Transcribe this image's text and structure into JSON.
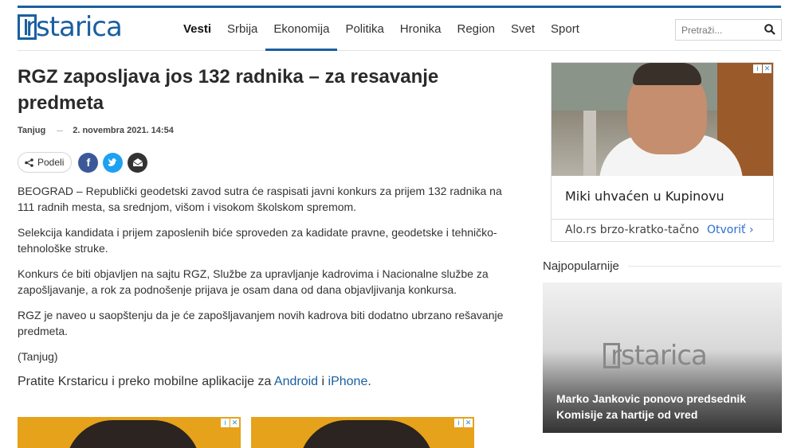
{
  "brand": {
    "logo_text": "rstarica",
    "logo_letter": "k",
    "accent": "#1a5fa0"
  },
  "nav": {
    "items": [
      {
        "label": "Vesti"
      },
      {
        "label": "Srbija"
      },
      {
        "label": "Ekonomija"
      },
      {
        "label": "Politika"
      },
      {
        "label": "Hronika"
      },
      {
        "label": "Region"
      },
      {
        "label": "Svet"
      },
      {
        "label": "Sport"
      }
    ],
    "active_index": 2
  },
  "search": {
    "placeholder": "Pretraži...",
    "icon": "search-icon"
  },
  "article": {
    "title": "RGZ zaposljava jos 132 radnika – za resavanje predmeta",
    "source": "Tanjug",
    "date": "2. novembra 2021. 14:54",
    "share_label": "Podeli",
    "paragraphs": [
      "BEOGRAD – Republički geodetski zavod sutra će raspisati javni konkurs za prijem 132 radnika na 111 radnih mesta, sa srednjom, višom i visokom školskom spremom.",
      "Selekcija kandidata i prijem zaposlenih biće sproveden za kadidate pravne, geodetske i tehničko-tehnološke struke.",
      "Konkurs će biti objavljen na sajtu RGZ, Službe za upravljanje kadrovima i Nacionalne službe za zapošljavanje, a rok za podnošenje prijava je osam dana od dana objavljivanja konkursa.",
      "RGZ je naveo u saopštenju da je će zapošljavanjem novih kadrova biti dodatno ubrzano rešavanje predmeta.",
      "(Tanjug)"
    ],
    "promo_prefix": "Pratite Krstaricu i preko mobilne aplikacije za ",
    "promo_android": "Android",
    "promo_and": " i ",
    "promo_iphone": "iPhone",
    "promo_suffix": "."
  },
  "side_ad": {
    "headline": "Miki uhvaćen u Kupinovu",
    "source": "Alo.rs brzo-kratko-tačno",
    "open_label": "Otvoriť"
  },
  "popular": {
    "label": "Najpopularnije",
    "card_caption": "Marko Jankovic ponovo predsednik Komisije za hartije od vred",
    "card_logo_text": "rstarica",
    "card_logo_letter": "k"
  }
}
